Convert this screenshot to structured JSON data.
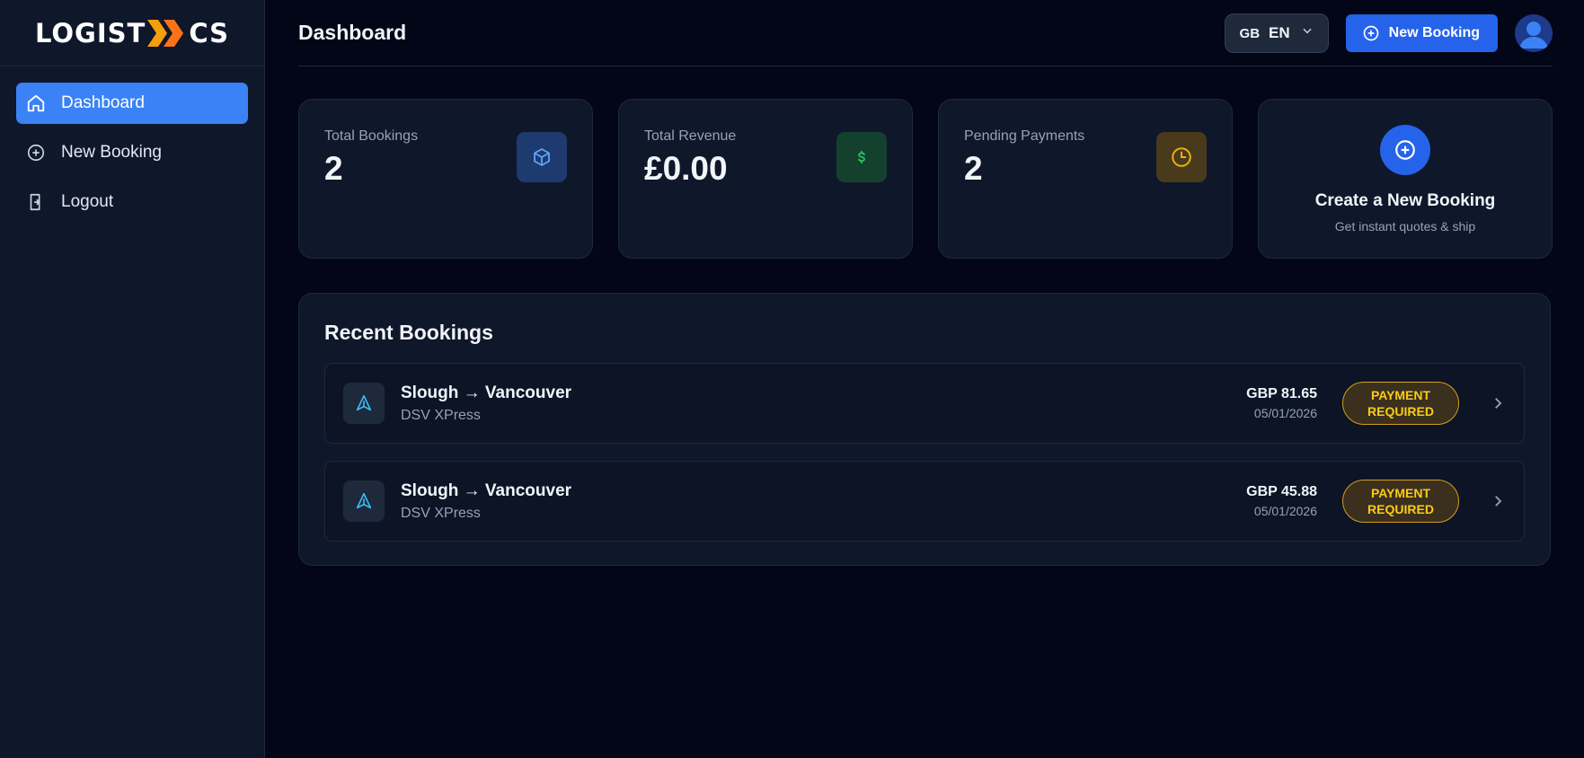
{
  "brand": {
    "logo_prefix": "LOGIST",
    "logo_suffix": "CS"
  },
  "sidebar": {
    "items": [
      {
        "label": "Dashboard",
        "icon": "home-icon",
        "active": true
      },
      {
        "label": "New Booking",
        "icon": "plus-circle-icon",
        "active": false
      },
      {
        "label": "Logout",
        "icon": "logout-icon",
        "active": false
      }
    ]
  },
  "header": {
    "title": "Dashboard",
    "language": {
      "code": "GB",
      "name": "EN"
    },
    "new_booking_label": "New Booking"
  },
  "stats": [
    {
      "label": "Total Bookings",
      "value": "2",
      "icon": "box-icon",
      "color": "#60a5fa"
    },
    {
      "label": "Total Revenue",
      "value": "£0.00",
      "icon": "dollar-icon",
      "color": "#22c55e"
    },
    {
      "label": "Pending Payments",
      "value": "2",
      "icon": "clock-icon",
      "color": "#eab308"
    }
  ],
  "create_card": {
    "title": "Create a New Booking",
    "subtitle": "Get instant quotes & ship"
  },
  "recent": {
    "title": "Recent Bookings",
    "bookings": [
      {
        "route": "Slough → Vancouver",
        "carrier": "DSV XPress",
        "price": "GBP 81.65",
        "date": "05/01/2026",
        "status": "PAYMENT REQUIRED"
      },
      {
        "route": "Slough → Vancouver",
        "carrier": "DSV XPress",
        "price": "GBP 45.88",
        "date": "05/01/2026",
        "status": "PAYMENT REQUIRED"
      }
    ]
  },
  "colors": {
    "accent": "#3b82f6",
    "button": "#2563eb",
    "background": "#020617",
    "panel": "#0f172a",
    "warning": "#facc15"
  }
}
